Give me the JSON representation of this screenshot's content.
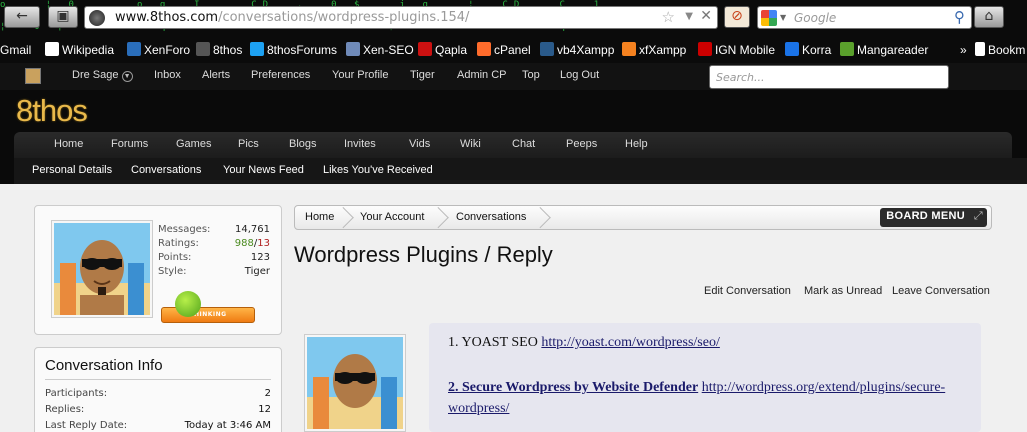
{
  "browser": {
    "url_domain": "www.8thos.com",
    "url_path": "/conversations/wordpress-plugins.154/",
    "search_engine": "Google",
    "bookmarks": [
      {
        "label": "Gmail",
        "color": "#d93025"
      },
      {
        "label": "Wikipedia",
        "color": "#ffffff"
      },
      {
        "label": "XenForo",
        "color": "#2a6ebb"
      },
      {
        "label": "8thos",
        "color": "#555555"
      },
      {
        "label": "8thosForums",
        "color": "#1da1f2"
      },
      {
        "label": "Xen-SEO",
        "color": "#6f8ab8"
      },
      {
        "label": "Qapla",
        "color": "#cc1111"
      },
      {
        "label": "cPanel",
        "color": "#ff6c2c"
      },
      {
        "label": "vb4Xampp",
        "color": "#2a5a8a"
      },
      {
        "label": "xfXampp",
        "color": "#f58220"
      },
      {
        "label": "IGN Mobile",
        "color": "#cc0000"
      },
      {
        "label": "Korra",
        "color": "#1a73e8"
      },
      {
        "label": "Mangareader",
        "color": "#5aa02c"
      }
    ],
    "bookmarks_overflow": "»",
    "bookmarks_extra": "Bookm"
  },
  "topbar": {
    "user": "Dre Sage",
    "links": [
      "Inbox",
      "Alerts",
      "Preferences",
      "Your Profile",
      "Tiger",
      "Admin CP",
      "Top",
      "Log Out"
    ],
    "search_placeholder": "Search..."
  },
  "site": {
    "logo": "8thos",
    "nav": [
      "Home",
      "Forums",
      "Games",
      "Pics",
      "Blogs",
      "Invites",
      "Vids",
      "Wiki",
      "Chat",
      "Peeps",
      "Help"
    ],
    "subnav": [
      "Personal Details",
      "Conversations",
      "Your News Feed",
      "Likes You've Received"
    ]
  },
  "profile": {
    "stats": [
      {
        "label": "Messages:",
        "value": "14,761"
      },
      {
        "label": "Points:",
        "value": "123"
      },
      {
        "label": "Style:",
        "value": "Tiger"
      }
    ],
    "ratings_label": "Ratings:",
    "ratings_good": "988",
    "ratings_sep": "/",
    "ratings_bad": "13",
    "mood": "THINKING"
  },
  "conversation_info": {
    "title": "Conversation Info",
    "rows": [
      {
        "label": "Participants:",
        "value": "2"
      },
      {
        "label": "Replies:",
        "value": "12"
      },
      {
        "label": "Last Reply Date:",
        "value": "Today at 3:46 AM"
      }
    ]
  },
  "breadcrumb": {
    "items": [
      "Home",
      "Your Account",
      "Conversations"
    ],
    "board_menu": "BOARD MENU"
  },
  "page": {
    "title": "Wordpress Plugins / Reply",
    "actions": [
      "Edit Conversation",
      "Mark as Unread",
      "Leave Conversation"
    ]
  },
  "message": {
    "item1_prefix": "1. YOAST SEO",
    "item1_link": "http://yoast.com/wordpress/seo/",
    "item2_title": "2. Secure Wordpress by Website Defender",
    "item2_link": "http://wordpress.org/extend/plugins/secure-wordpress/"
  }
}
